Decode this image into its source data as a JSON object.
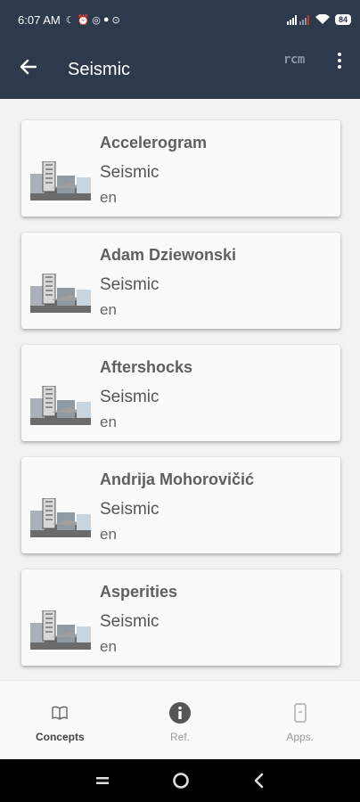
{
  "status_bar": {
    "time": "6:07 AM",
    "battery": "84"
  },
  "app_bar": {
    "title": "Seismic",
    "logo_text": "rcm",
    "back_icon": "arrow-left-icon",
    "menu_icon": "more-vert-icon"
  },
  "list": {
    "items": [
      {
        "title": "Accelerogram",
        "category": "Seismic",
        "language": "en",
        "icon": "building-thumbnail"
      },
      {
        "title": "Adam Dziewonski",
        "category": "Seismic",
        "language": "en",
        "icon": "building-thumbnail"
      },
      {
        "title": "Aftershocks",
        "category": "Seismic",
        "language": "en",
        "icon": "building-thumbnail"
      },
      {
        "title": "Andrija Mohorovičić",
        "category": "Seismic",
        "language": "en",
        "icon": "building-thumbnail"
      },
      {
        "title": "Asperities",
        "category": "Seismic",
        "language": "en",
        "icon": "building-thumbnail"
      }
    ]
  },
  "bottom_nav": {
    "tabs": [
      {
        "label": "Concepts",
        "icon": "book-icon",
        "active": true
      },
      {
        "label": "Ref.",
        "icon": "info-icon",
        "active": false
      },
      {
        "label": "Apps.",
        "icon": "phone-icon",
        "active": false
      }
    ]
  },
  "colors": {
    "app_bar": "#2e3a4b",
    "card_background": "#fafafa",
    "page_background": "#f2f2f2"
  }
}
